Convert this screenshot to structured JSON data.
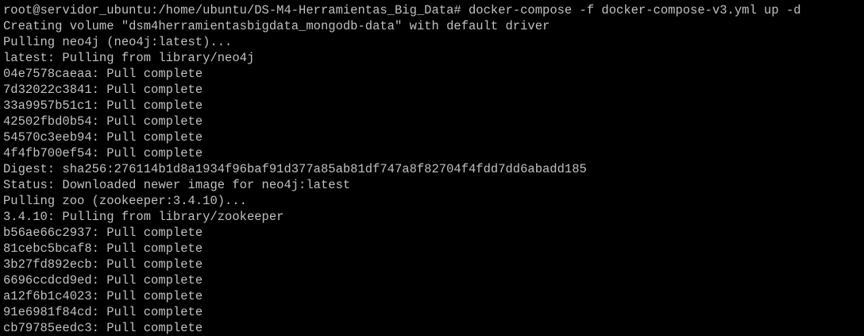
{
  "terminal": {
    "colors": {
      "background": "#000000",
      "foreground": "#c0c0c0"
    },
    "prompt": "root@servidor_ubuntu:/home/ubuntu/DS-M4-Herramientas_Big_Data# ",
    "command": "docker-compose -f docker-compose-v3.yml up -d",
    "lines": [
      "Creating volume \"dsm4herramientasbigdata_mongodb-data\" with default driver",
      "Pulling neo4j (neo4j:latest)...",
      "latest: Pulling from library/neo4j",
      "04e7578caeaa: Pull complete",
      "7d32022c3841: Pull complete",
      "33a9957b51c1: Pull complete",
      "42502fbd0b54: Pull complete",
      "54570c3eeb94: Pull complete",
      "4f4fb700ef54: Pull complete",
      "Digest: sha256:276114b1d8a1934f96baf91d377a85ab81df747a8f82704f4fdd7dd6abadd185",
      "Status: Downloaded newer image for neo4j:latest",
      "Pulling zoo (zookeeper:3.4.10)...",
      "3.4.10: Pulling from library/zookeeper",
      "b56ae66c2937: Pull complete",
      "81cebc5bcaf8: Pull complete",
      "3b27fd892ecb: Pull complete",
      "6696ccdcd9ed: Pull complete",
      "a12f6b1c4023: Pull complete",
      "91e6981f84cd: Pull complete",
      "cb79785eedc3: Pull complete"
    ]
  }
}
